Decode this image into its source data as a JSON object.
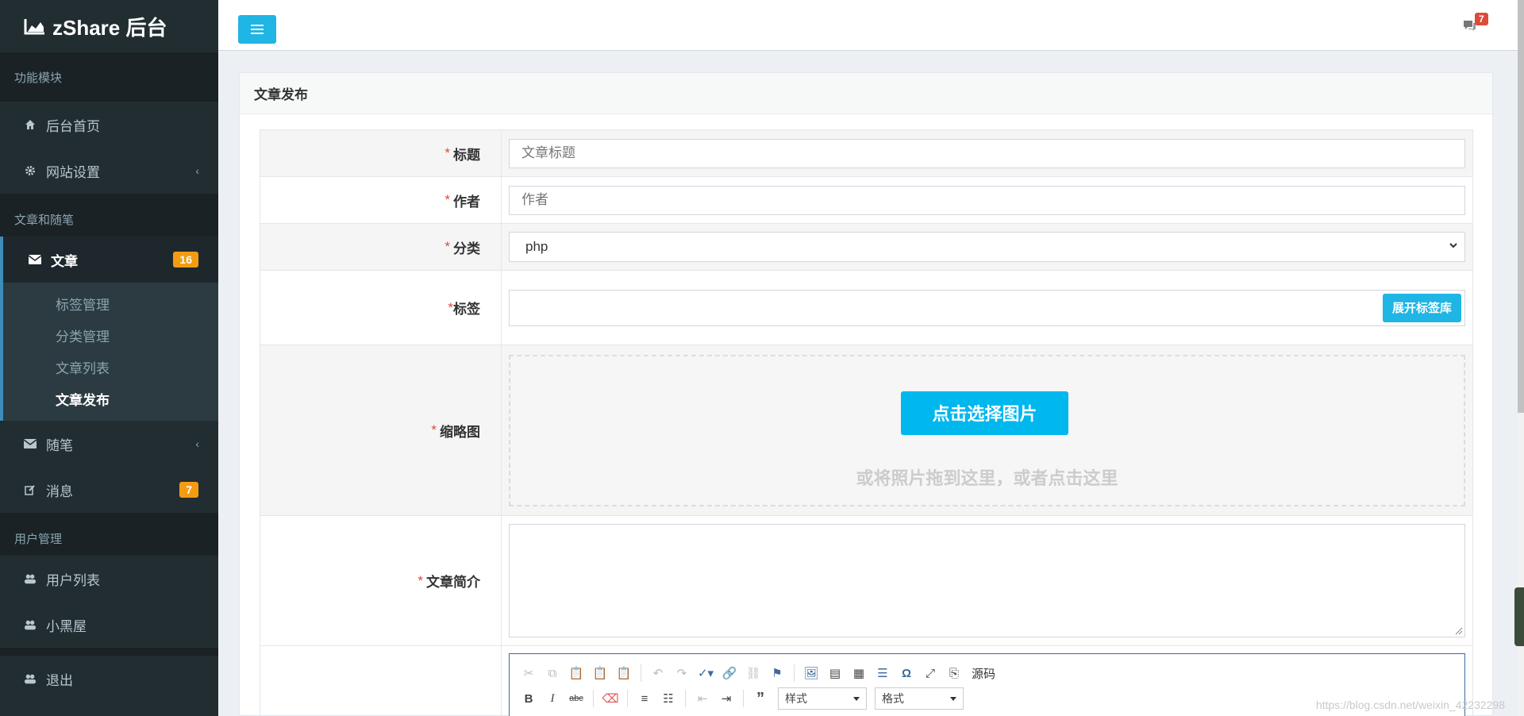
{
  "brand": {
    "title": "zShare 后台"
  },
  "sidebar": {
    "sections": [
      {
        "header": "功能模块"
      },
      {
        "header": "文章和随笔"
      },
      {
        "header": "用户管理"
      }
    ],
    "items": {
      "home": "后台首页",
      "settings": "网站设置",
      "article": "文章",
      "article_badge": "16",
      "essay": "随笔",
      "message": "消息",
      "message_badge": "7",
      "user_list": "用户列表",
      "blackroom": "小黑屋",
      "logout": "退出"
    },
    "article_sub": [
      "标签管理",
      "分类管理",
      "文章列表",
      "文章发布"
    ]
  },
  "header": {
    "message_count": "7"
  },
  "page": {
    "title": "文章发布",
    "form": {
      "title_label": "标题",
      "title_placeholder": "文章标题",
      "author_label": "作者",
      "author_placeholder": "作者",
      "category_label": "分类",
      "category_value": "php",
      "tags_label": "标签",
      "tags_button": "展开标签库",
      "thumb_label": "缩略图",
      "upload_button": "点击选择图片",
      "upload_hint": "或将照片拖到这里，或者点击这里",
      "summary_label": "文章简介",
      "required_mark": "*"
    },
    "editor": {
      "source_label": "源码",
      "style_combo": "样式",
      "format_combo": "格式"
    }
  },
  "watermark": "https://blog.csdn.net/weixin_42232298",
  "colors": {
    "accent": "#1fb5e4",
    "sidebar_bg": "#222d32",
    "badge_orange": "#f39c12",
    "badge_red": "#dd4b39"
  }
}
